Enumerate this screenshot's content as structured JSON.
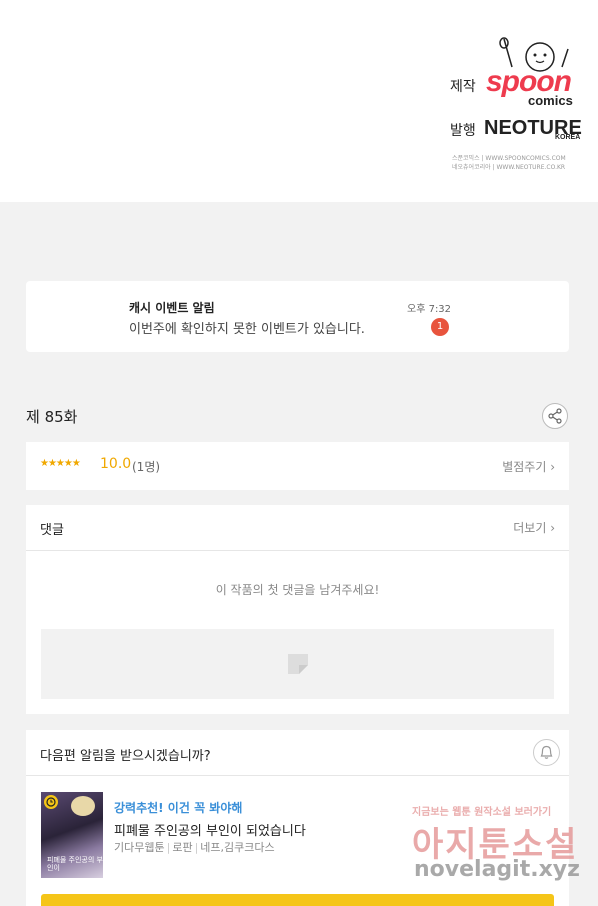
{
  "credits": {
    "production_label": "제작",
    "spoon_logo": "spoon",
    "spoon_sub": "comics",
    "publisher_label": "발행",
    "neoture_logo": "NEOTURE",
    "neoture_sub": "KOREA",
    "fine_line1": "스푼코믹스 | WWW.SPOONCOMICS.COM",
    "fine_line2": "네오츄어코리아 | WWW.NEOTURE.CO.KR"
  },
  "notification": {
    "title": "캐시 이벤트 알림",
    "message": "이번주에 확인하지 못한 이벤트가 있습니다.",
    "time": "오후 7:32",
    "badge_count": "1",
    "badge_color": "#e8543d"
  },
  "episode": {
    "title": "제 85화",
    "share_icon": "share-icon"
  },
  "rating": {
    "stars": "★★★★★",
    "value": "10.0",
    "count": "(1명)",
    "rate_link": "별점주기 ›",
    "accent_color": "#f0a800"
  },
  "comments": {
    "header": "댓글",
    "more_link": "더보기 ›",
    "empty_message": "이 작품의 첫 댓글을 남겨주세요!"
  },
  "next_episode": {
    "question": "다음편 알림을 받으시겠습니까?",
    "bell_icon": "bell-icon",
    "recommendation": {
      "tag": "강력추천! 이건 꼭 봐야해",
      "title": "피폐물 주인공의 부인이 되었습니다",
      "meta": [
        "기다무웹툰",
        "로판",
        "네프,김쿠크다스"
      ],
      "thumb_title": "피폐물 주인공의 부인이"
    }
  },
  "watermark": {
    "top": "지금보는 웹툰 원작소설 보러가기",
    "main": "아지툰소설",
    "url": "novelagit.xyz"
  }
}
